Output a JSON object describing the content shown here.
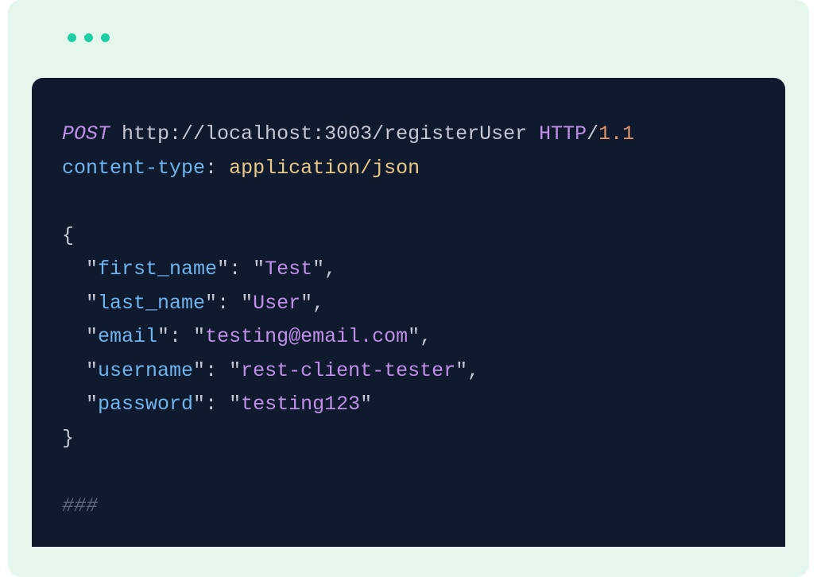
{
  "request": {
    "method": "POST",
    "url": "http://localhost:3003/registerUser",
    "protocol_label": "HTTP",
    "protocol_separator": "/",
    "protocol_version": "1.1",
    "header_name": "content-type",
    "header_separator": ":",
    "header_value": "application/json"
  },
  "body": {
    "open_brace": "{",
    "close_brace": "}",
    "quote": "\"",
    "colon": ":",
    "comma": ",",
    "fields": {
      "first_name_key": "first_name",
      "first_name_value": "Test",
      "last_name_key": "last_name",
      "last_name_value": "User",
      "email_key": "email",
      "email_value": "testing@email.com",
      "username_key": "username",
      "username_value": "rest-client-tester",
      "password_key": "password",
      "password_value": "testing123"
    }
  },
  "separator_line": "###",
  "colors": {
    "window_bg": "#e5f7ec",
    "code_bg": "#0f1a2f",
    "accent_dot": "#1dcda3",
    "method": "#c090e8",
    "url": "#c5c8d4",
    "proto_ver": "#e3946a",
    "header_name": "#6fb4ec",
    "header_value": "#e9c987",
    "value_purple": "#c090e8",
    "separator_grey": "#5e6a7f"
  }
}
